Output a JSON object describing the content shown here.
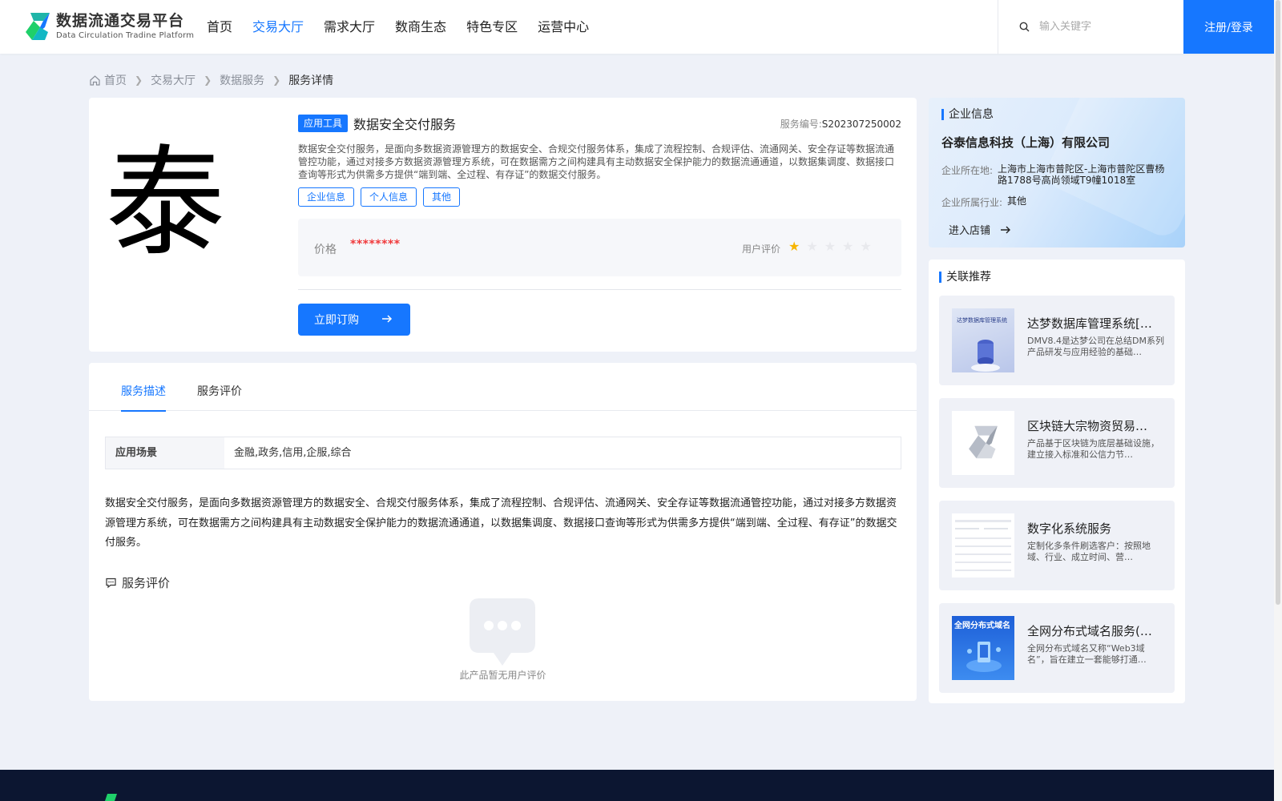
{
  "header": {
    "logo_title": "数据流通交易平台",
    "logo_subtitle": "Data Circulation Tradine Platform",
    "nav": [
      "首页",
      "交易大厅",
      "需求大厅",
      "数商生态",
      "特色专区",
      "运营中心"
    ],
    "active_nav": "交易大厅",
    "search_placeholder": "输入关键字",
    "login_label": "注册/登录"
  },
  "breadcrumb": [
    "首页",
    "交易大厅",
    "数据服务",
    "服务详情"
  ],
  "product": {
    "image_glyph": "泰",
    "category_tag": "应用工具",
    "title": "数据安全交付服务",
    "code_label": "服务编号:",
    "code_value": "S202307250002",
    "description": "数据安全交付服务，是面向多数据资源管理方的数据安全、合规交付服务体系，集成了流程控制、合规评估、流通网关、安全存证等数据流通管控功能，通过对接多方数据资源管理方系统，可在数据需方之间构建具有主动数据安全保护能力的数据流通通道，以数据集调度、数据接口查询等形式为供需多方提供“端到端、全过程、有存证”的数据交付服务。",
    "tags": [
      "企业信息",
      "个人信息",
      "其他"
    ],
    "price_label": "价格",
    "price_value": "********",
    "rating_label": "用户评价",
    "rating": 1,
    "rating_max": 5,
    "order_label": "立即订购"
  },
  "detail": {
    "tabs": [
      "服务描述",
      "服务评价"
    ],
    "active_tab": "服务描述",
    "scene_label": "应用场景",
    "scene_value": "金融,政务,信用,企服,综合",
    "text": "数据安全交付服务，是面向多数据资源管理方的数据安全、合规交付服务体系，集成了流程控制、合规评估、流通网关、安全存证等数据流通管控功能，通过对接多方数据资源管理方系统，可在数据需方之间构建具有主动数据安全保护能力的数据流通通道，以数据集调度、数据接口查询等形式为供需多方提供“端到端、全过程、有存证”的数据交付服务。",
    "review_title": "服务评价",
    "empty_text": "此产品暂无用户评价"
  },
  "company": {
    "section_title": "企业信息",
    "name": "谷泰信息科技（上海）有限公司",
    "location_label": "企业所在地:",
    "location_value": "上海市上海市普陀区-上海市普陀区曹杨路1788号高尚领域T9幢1018室",
    "industry_label": "企业所属行业:",
    "industry_value": "其他",
    "enter_label": "进入店铺"
  },
  "recommend": {
    "section_title": "关联推荐",
    "items": [
      {
        "name": "达梦数据库管理系统[…",
        "desc": "DMV8.4是达梦公司在总结DM系列产品研发与应用经验的基础…",
        "thumb_text": "达梦数据库管理系统"
      },
      {
        "name": "区块链大宗物资贸易…",
        "desc": "产品基于区块链为底层基础设施，建立接入标准和公信力节…",
        "thumb_text": ""
      },
      {
        "name": "数字化系统服务",
        "desc": "定制化多条件刷选客户：按照地域、行业、成立时间、营…",
        "thumb_text": ""
      },
      {
        "name": "全网分布式域名服务(…",
        "desc": "全网分布式域名又称“Web3域名”，旨在建立一套能够打通…",
        "thumb_text": "全网分布式域名"
      }
    ]
  },
  "colors": {
    "accent": "#1677ff",
    "price": "#f0393b",
    "star": "#f7b500",
    "footer": "#0c1631"
  }
}
